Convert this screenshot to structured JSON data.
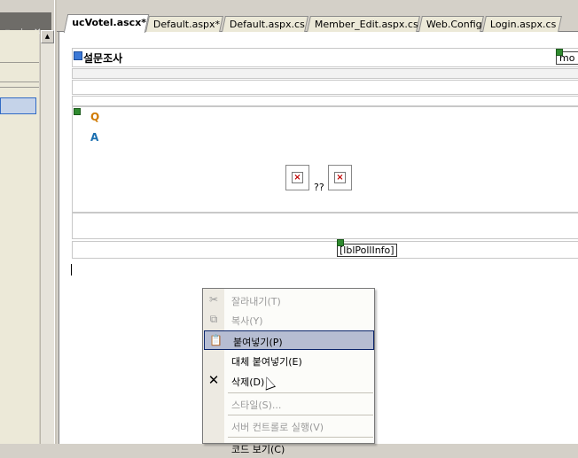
{
  "left_panel": {
    "title_icons": "▾ ⊥ ✕"
  },
  "tabs": [
    {
      "label": "ucVotel.ascx*",
      "active": true
    },
    {
      "label": "Default.aspx*",
      "active": false
    },
    {
      "label": "Default.aspx.cs",
      "active": false
    },
    {
      "label": "Member_Edit.aspx.cs",
      "active": false
    },
    {
      "label": "Web.Config",
      "active": false
    },
    {
      "label": "Login.aspx.cs",
      "active": false
    }
  ],
  "designer": {
    "survey_title": "설문조사",
    "mode_box": "mo",
    "question_label": "Q",
    "answer_label": "A",
    "image_separator": "??",
    "info_label": "[lblPollInfo]"
  },
  "context_menu": {
    "items": [
      {
        "label": "잘라내기(T)",
        "icon": "scissors-icon",
        "disabled": true
      },
      {
        "label": "복사(Y)",
        "icon": "copy-icon",
        "disabled": true
      },
      {
        "label": "붙여넣기(P)",
        "icon": "paste-icon",
        "disabled": false,
        "hover": true
      },
      {
        "label": "대체 붙여넣기(E)",
        "icon": "",
        "disabled": false
      },
      {
        "label": "삭제(D)",
        "icon": "delete-icon",
        "disabled": false
      },
      {
        "label": "스타일(S)...",
        "icon": "",
        "disabled": true
      },
      {
        "label": "서버 컨트롤로 실행(V)",
        "icon": "",
        "disabled": true
      },
      {
        "label": "코드 보기(C)",
        "icon": "",
        "disabled": false
      }
    ]
  }
}
